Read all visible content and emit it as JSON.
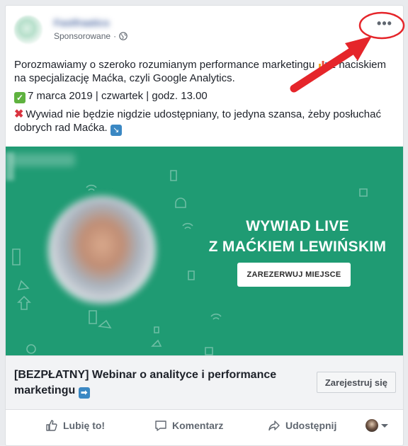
{
  "post": {
    "page_name": "Fastfraatics",
    "sponsored_label": "Sponsorowane",
    "sponsored_separator": "·",
    "more_label": "•••",
    "text": {
      "line1_a": "Porozmawiamy o szeroko rozumianym performance marketingu ",
      "line1_b": " z naciskiem na specjalizację Maćka, czyli Google Analytics.",
      "line2": "7 marca 2019 | czwartek | godz. 13.00",
      "line3": "Wywiad nie będzie nigdzie udostępniany, to jedyna szansa, żeby posłuchać dobrych rad Maćka. "
    },
    "icons": {
      "chart": "bar-chart-emoji",
      "check": "check-mark-emoji",
      "x": "cross-mark-emoji",
      "arrow": "arrow-down-right-emoji",
      "globe": "globe-icon",
      "more": "more-options-icon"
    },
    "emoji_glyphs": {
      "check": "✓",
      "x": "✖",
      "arrow": "↘",
      "link_arrow": "➡"
    }
  },
  "banner": {
    "headline_line1": "WYWIAD LIVE",
    "headline_line2": "Z MAĆKIEM LEWIŃSKIM",
    "cta": "ZAREZERWUJ MIEJSCE",
    "background_color": "#1f9b73"
  },
  "link": {
    "title": "[BEZPŁATNY] Webinar o analityce i performance marketingu",
    "button": "Zarejestruj się"
  },
  "actions": {
    "like": "Lubię to!",
    "comment": "Komentarz",
    "share": "Udostępnij"
  },
  "annotation": {
    "color": "#e5252a"
  }
}
